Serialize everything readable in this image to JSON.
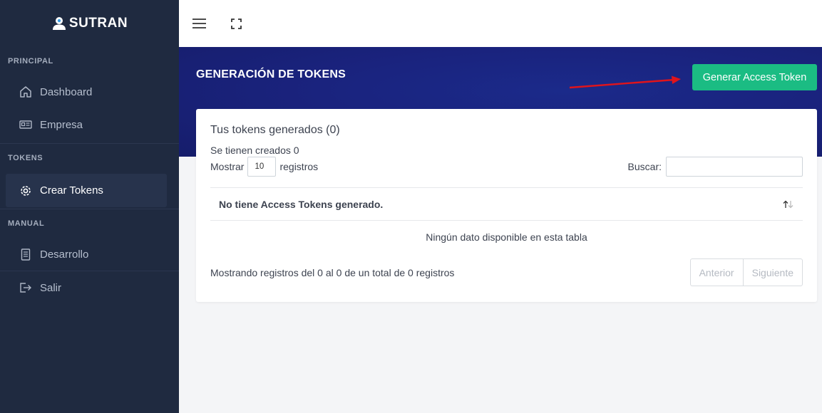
{
  "brand": {
    "name": "SUTRAN"
  },
  "sidebar": {
    "sections": [
      {
        "label": "PRINCIPAL",
        "items": [
          {
            "label": "Dashboard",
            "icon": "home-icon"
          },
          {
            "label": "Empresa",
            "icon": "id-card-icon"
          }
        ]
      },
      {
        "label": "TOKENS",
        "items": [
          {
            "label": "Crear Tokens",
            "icon": "gear-icon",
            "active": true
          }
        ]
      },
      {
        "label": "MANUAL",
        "items": [
          {
            "label": "Desarrollo",
            "icon": "document-icon"
          },
          {
            "label": "Salir",
            "icon": "logout-icon"
          }
        ]
      }
    ]
  },
  "header": {
    "title": "GENERACIÓN DE TOKENS",
    "action_label": "Generar Access Token"
  },
  "card": {
    "title": "Tus tokens generados (0)",
    "subtitle": "Se tienen creados 0",
    "length_prefix": "Mostrar",
    "length_value": "10",
    "length_suffix": "registros",
    "search_label": "Buscar:",
    "search_value": "",
    "column_header": "No tiene Access Tokens generado.",
    "empty_message": "Ningún dato disponible en esta tabla",
    "info": "Mostrando registros del 0 al 0 de un total de 0 registros",
    "prev_label": "Anterior",
    "next_label": "Siguiente"
  },
  "colors": {
    "sidebar_bg": "#1f2a40",
    "hero_bg": "#1a237e",
    "accent_green": "#1bbc83",
    "arrow_red": "#e0141b"
  }
}
